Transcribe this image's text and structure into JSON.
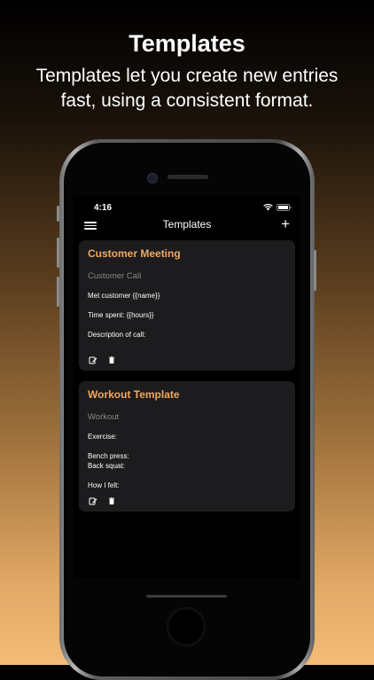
{
  "promo": {
    "headline": "Templates",
    "subline_1": "Templates let you create new entries",
    "subline_2": "fast, using a consistent format."
  },
  "status_bar": {
    "time": "4:16",
    "icons": [
      "wifi-icon",
      "battery-icon"
    ]
  },
  "nav": {
    "title": "Templates",
    "menu_icon": "hamburger-menu-icon",
    "add_label": "+"
  },
  "templates": [
    {
      "title": "Customer Meeting",
      "subtitle": "Customer Call",
      "lines": [
        "Met customer {{name}}",
        "Time spent: {{hours}}",
        "Description of call:"
      ],
      "actions": [
        "edit-icon",
        "trash-icon"
      ]
    },
    {
      "title": "Workout Template",
      "subtitle": "Workout",
      "lines": [
        "Exercise:",
        "Bench press:",
        "Back squat:",
        "How I felt:"
      ],
      "actions": [
        "edit-icon",
        "trash-icon"
      ]
    }
  ],
  "colors": {
    "accent": "#f0a860",
    "card_bg": "#1c1c1e",
    "screen_bg": "#000000",
    "muted_text": "#8a8a8a"
  }
}
